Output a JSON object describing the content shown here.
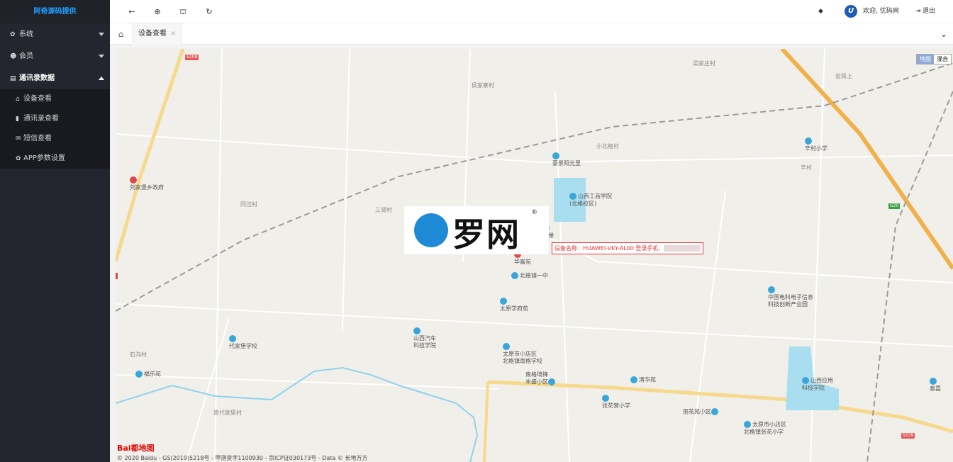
{
  "sidebar": {
    "brand": "阿奇源码提供",
    "menu": [
      {
        "label": "系统",
        "icon": "gear-icon"
      },
      {
        "label": "会员",
        "icon": "users-icon"
      },
      {
        "label": "通讯录数据",
        "icon": "card-icon"
      }
    ],
    "submenu": [
      {
        "label": "设备查看",
        "icon": "lock-icon"
      },
      {
        "label": "通讯录查看",
        "icon": "book-icon"
      },
      {
        "label": "短信查看",
        "icon": "envelope-icon"
      },
      {
        "label": "APP参数设置",
        "icon": "gear-icon"
      }
    ]
  },
  "topbar": {
    "welcome": "欢迎, 优码网",
    "logout": "退出",
    "logo_letter": "U"
  },
  "tabs": {
    "active_tab": "设备查看",
    "close_glyph": "×"
  },
  "map": {
    "map_type": [
      "地图",
      "混合"
    ],
    "device_label": "设备名称：HUAWEI-VKY-AL00 登录手机：",
    "watermark_text": "罗网",
    "watermark_reg": "®",
    "baidu_logo": "Bai都地图",
    "copyright": "© 2020 Baidu - GS(2019)5218号 - 甲测资字1100930 - 京ICP证030173号 - Data © 长地万方",
    "road_badges": [
      "S208",
      "G20",
      "S339"
    ],
    "villages": [
      "侯家寨村",
      "梁家庄村",
      "盐局上",
      "小北格村",
      "辛村",
      "同过村",
      "三贤村",
      "石沟村",
      "南代家堡村"
    ],
    "pois": [
      "刘家堡乡政府",
      "豪景阳光里",
      "辛村小学",
      "山西工商学院\n(北格校区)",
      "大楼",
      "华富苑",
      "北格镇一中",
      "太原学府苑",
      "中国电科电子信息\n科技创新产业园",
      "山西汽车\n科技学院",
      "代家堡学校",
      "太原市小店区\n北格镇南格学校",
      "福乐苑",
      "南格琦锋\n丰盛小区",
      "清华苑",
      "张花营小学",
      "丽花苑小区",
      "太原市小店区\n北格镇张花小学",
      "山西应用\n科技学院",
      "泰嘉"
    ]
  }
}
